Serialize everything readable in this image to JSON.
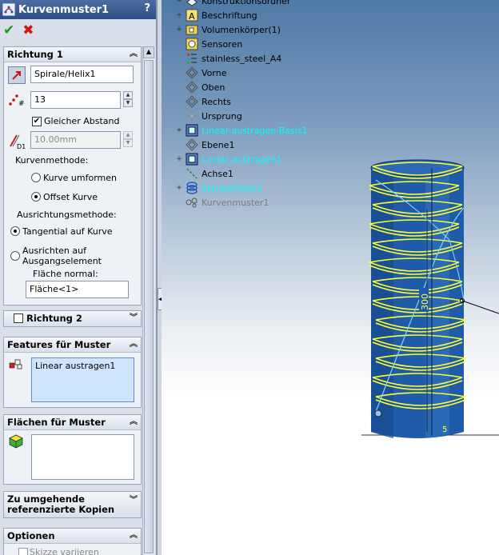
{
  "property_manager": {
    "title": "Kurvenmuster1",
    "help": "?",
    "ok_icon": "checkmark-icon",
    "cancel_icon": "x-icon"
  },
  "richtung1": {
    "header": "Richtung 1",
    "path_value": "Spirale/Helix1",
    "instances_value": "13",
    "equal_spacing_label": "Gleicher Abstand",
    "equal_spacing_checked": true,
    "distance_value": "10.00mm",
    "curve_method_label": "Kurvenmethode:",
    "curve_options": [
      "Kurve umformen",
      "Offset Kurve"
    ],
    "curve_selected": "Offset Kurve",
    "align_method_label": "Ausrichtungsmethode:",
    "align_option_1": "Tangential auf Kurve",
    "align_option_2_line1": "Ausrichten auf",
    "align_option_2_line2": "Ausgangselement",
    "align_selected": "Tangential auf Kurve",
    "face_normal_label": "Fläche normal:",
    "face_normal_value": "Fläche<1>"
  },
  "richtung2": {
    "header": "Richtung 2",
    "checked": false
  },
  "features": {
    "header": "Features für Muster",
    "items": [
      "Linear austragen1"
    ]
  },
  "flaechen": {
    "header": "Flächen für Muster",
    "items": []
  },
  "kopien": {
    "header_line1": "Zu umgehende",
    "header_line2": "referenzierte Kopien"
  },
  "optionen": {
    "header": "Optionen",
    "skizze_label": "Skizze variieren"
  },
  "tree": {
    "items": [
      {
        "label": "Konstruktionsordner",
        "expand": "+",
        "style": "normal"
      },
      {
        "label": "Beschriftung",
        "expand": "+",
        "style": "normal"
      },
      {
        "label": "Volumenkörper(1)",
        "expand": "+",
        "style": "normal"
      },
      {
        "label": "Sensoren",
        "expand": "",
        "style": "normal"
      },
      {
        "label": "stainless_steel_A4",
        "expand": "",
        "style": "normal"
      },
      {
        "label": "Vorne",
        "expand": "",
        "style": "normal"
      },
      {
        "label": "Oben",
        "expand": "",
        "style": "normal"
      },
      {
        "label": "Rechts",
        "expand": "",
        "style": "normal"
      },
      {
        "label": "Ursprung",
        "expand": "",
        "style": "normal"
      },
      {
        "label": "Linear-austragen-Basis1",
        "expand": "+",
        "style": "cyan"
      },
      {
        "label": "Ebene1",
        "expand": "",
        "style": "normal"
      },
      {
        "label": "Linear austragen1",
        "expand": "+",
        "style": "cyan"
      },
      {
        "label": "Achse1",
        "expand": "",
        "style": "normal"
      },
      {
        "label": "Spirale/Helix1",
        "expand": "+",
        "style": "cyan"
      },
      {
        "label": "Kurvenmuster1",
        "expand": "",
        "style": "gray"
      }
    ]
  },
  "viewport": {
    "dimension_label": "300",
    "dimension_label_small": "5",
    "colors": {
      "cylinder": "#1e5ba8",
      "coil": "#ffff33",
      "helix": "#7fd3ff"
    }
  }
}
